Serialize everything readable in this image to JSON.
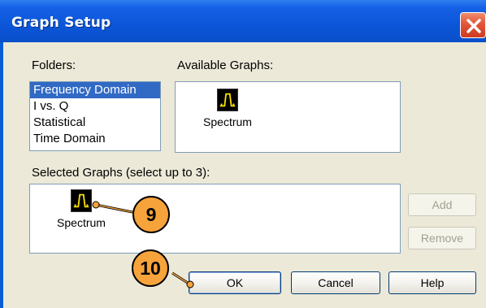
{
  "window": {
    "title": "Graph Setup"
  },
  "folders": {
    "label": "Folders:",
    "items": [
      "Frequency Domain",
      "I vs. Q",
      "Statistical",
      "Time Domain"
    ],
    "selected_index": 0
  },
  "available": {
    "label": "Available Graphs:",
    "graphs": [
      {
        "label": "Spectrum",
        "icon": "spectrum-icon"
      }
    ]
  },
  "selected": {
    "label": "Selected Graphs (select up to 3):",
    "graphs": [
      {
        "label": "Spectrum",
        "icon": "spectrum-icon"
      }
    ]
  },
  "buttons": {
    "add": "Add",
    "remove": "Remove",
    "ok": "OK",
    "cancel": "Cancel",
    "help": "Help"
  },
  "callouts": [
    "9",
    "10"
  ],
  "colors": {
    "titlebar": "#0a5bd6",
    "dialog_bg": "#ece9d8",
    "selection": "#316ac5",
    "callout": "#f7a33b",
    "icon_trace": "#f5e000"
  }
}
